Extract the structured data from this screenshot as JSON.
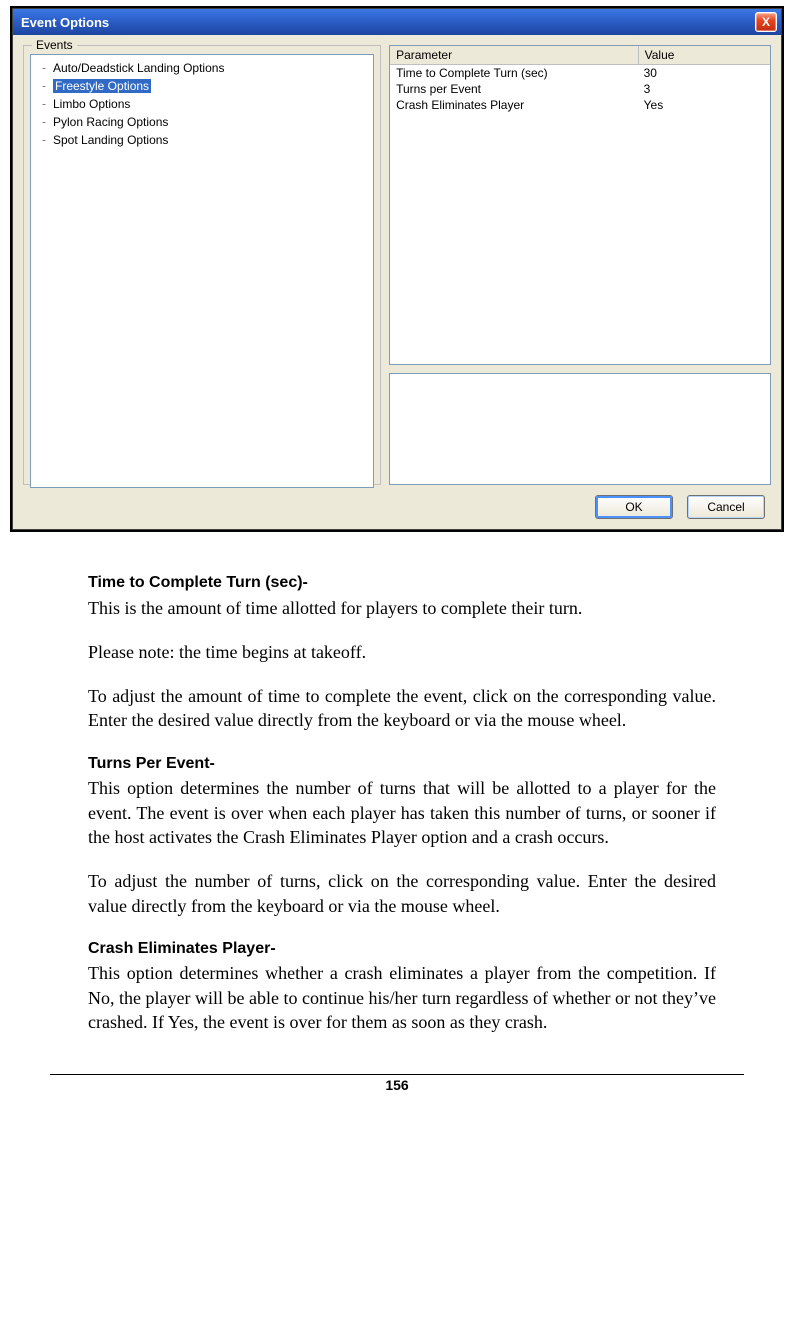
{
  "dialog": {
    "title": "Event Options",
    "close_glyph": "X",
    "tree_legend": "Events",
    "tree_items": [
      "Auto/Deadstick Landing Options",
      "Freestyle Options",
      "Limbo Options",
      "Pylon Racing Options",
      "Spot Landing Options"
    ],
    "params": {
      "header_param": "Parameter",
      "header_value": "Value",
      "rows": [
        {
          "p": "Time to Complete Turn (sec)",
          "v": "30"
        },
        {
          "p": "Turns per Event",
          "v": "3"
        },
        {
          "p": "Crash Eliminates Player",
          "v": "Yes"
        }
      ]
    },
    "buttons": {
      "ok": "OK",
      "cancel": "Cancel"
    }
  },
  "doc": {
    "h1": "Time to Complete Turn (sec)-",
    "p1": "This is the amount of time allotted for players to complete their turn.",
    "p2": "Please note:  the time begins at takeoff.",
    "p3": "To adjust the amount of time to complete the event, click on the corresponding value.  Enter the desired value directly from the keyboard or via the mouse wheel.",
    "h2": "Turns Per Event-",
    "p4": "This option determines the number of turns that will be allotted to a player for the event.  The event is over when each player has taken this number of turns, or sooner if the host activates the Crash Eliminates Player option and a crash occurs.",
    "p5": "To adjust the number of turns, click on the corresponding value.  Enter the desired value directly from the keyboard or via the mouse wheel.",
    "h3": "Crash Eliminates Player-",
    "p6": "This option determines whether a crash eliminates a player from the competition.  If No, the player will be able to continue his/her turn regardless of whether or not they’ve crashed.  If Yes, the event is over for them as soon as they crash."
  },
  "page_number": "156"
}
